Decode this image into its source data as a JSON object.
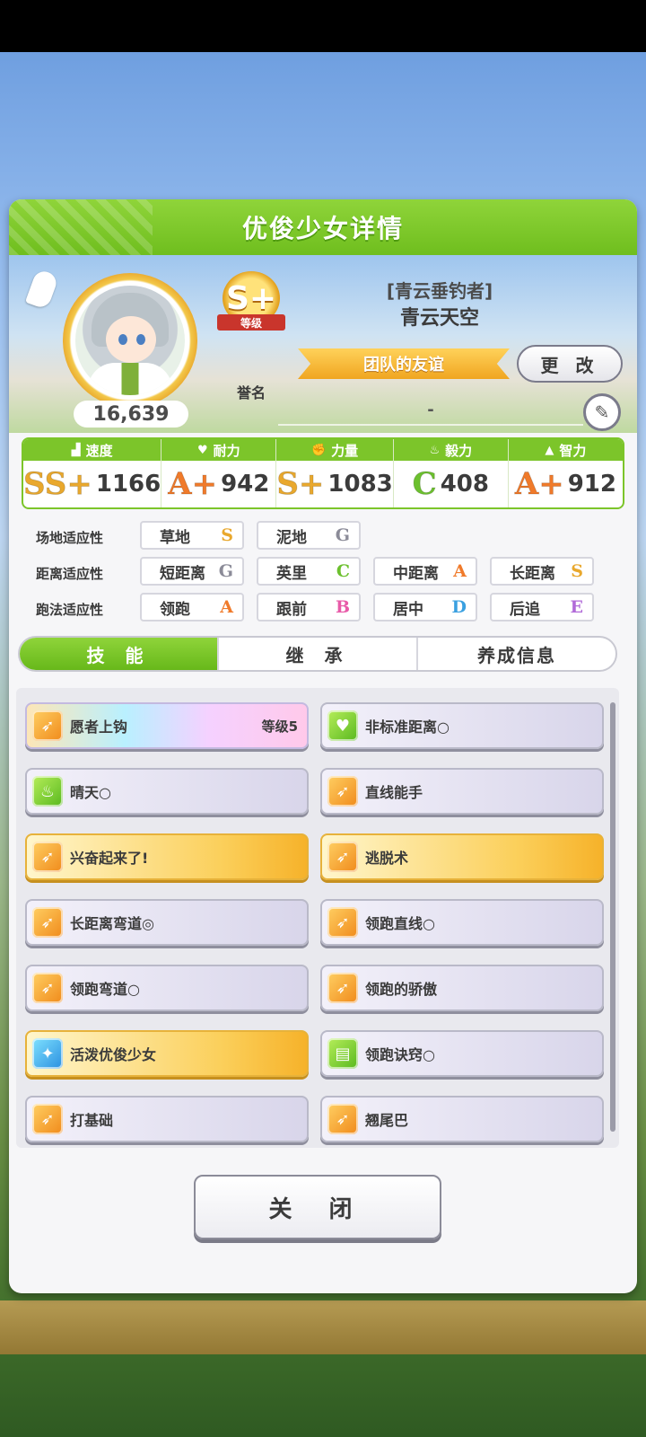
{
  "header": {
    "title": "优俊少女详情"
  },
  "profile": {
    "fans": "16,639",
    "rank": {
      "grade": "S+",
      "ribbon": "等级",
      "label": "誉名"
    },
    "epithet": "[青云垂钓者]",
    "name": "青云天空",
    "title_ribbon": "团队的友谊",
    "change_label": "更 改",
    "placeholder": "-"
  },
  "stats": [
    {
      "label": "速度",
      "icon": "shoe-icon",
      "grade": "SS+",
      "value": "1166",
      "color": "#e9a82d"
    },
    {
      "label": "耐力",
      "icon": "heart-icon",
      "grade": "A+",
      "value": "942",
      "color": "#f07a2a"
    },
    {
      "label": "力量",
      "icon": "arm-icon",
      "grade": "S+",
      "value": "1083",
      "color": "#e9a82d"
    },
    {
      "label": "毅力",
      "icon": "fire-icon",
      "grade": "C",
      "value": "408",
      "color": "#6cc02e"
    },
    {
      "label": "智力",
      "icon": "cap-icon",
      "grade": "A+",
      "value": "912",
      "color": "#f07a2a"
    }
  ],
  "aptitudes": [
    {
      "label": "场地适应性",
      "items": [
        {
          "name": "草地",
          "grade": "S",
          "color": "#e9a82d"
        },
        {
          "name": "泥地",
          "grade": "G",
          "color": "#8b8b98"
        }
      ]
    },
    {
      "label": "距离适应性",
      "items": [
        {
          "name": "短距离",
          "grade": "G",
          "color": "#8b8b98"
        },
        {
          "name": "英里",
          "grade": "C",
          "color": "#6cc02e"
        },
        {
          "name": "中距离",
          "grade": "A",
          "color": "#f07a2a"
        },
        {
          "name": "长距离",
          "grade": "S",
          "color": "#e9a82d"
        }
      ]
    },
    {
      "label": "跑法适应性",
      "items": [
        {
          "name": "领跑",
          "grade": "A",
          "color": "#f07a2a"
        },
        {
          "name": "跟前",
          "grade": "B",
          "color": "#e85aa8"
        },
        {
          "name": "居中",
          "grade": "D",
          "color": "#3aa0e0"
        },
        {
          "name": "后追",
          "grade": "E",
          "color": "#b16ad8"
        }
      ]
    }
  ],
  "tabs": [
    "技 能",
    "继 承",
    "养成信息"
  ],
  "skills": [
    {
      "name": "愿者上钩",
      "level": "等级5",
      "style": "rainbow",
      "icon": "orange"
    },
    {
      "name": "非标准距离○",
      "level": "",
      "style": "",
      "icon": "green"
    },
    {
      "name": "晴天○",
      "level": "",
      "style": "",
      "icon": "green"
    },
    {
      "name": "直线能手",
      "level": "",
      "style": "",
      "icon": "orange"
    },
    {
      "name": "兴奋起来了!",
      "level": "",
      "style": "gold",
      "icon": "orange"
    },
    {
      "name": "逃脱术",
      "level": "",
      "style": "gold",
      "icon": "orange"
    },
    {
      "name": "长距离弯道◎",
      "level": "",
      "style": "",
      "icon": "orange"
    },
    {
      "name": "领跑直线○",
      "level": "",
      "style": "",
      "icon": "orange"
    },
    {
      "name": "领跑弯道○",
      "level": "",
      "style": "",
      "icon": "orange"
    },
    {
      "name": "领跑的骄傲",
      "level": "",
      "style": "",
      "icon": "orange"
    },
    {
      "name": "活泼优俊少女",
      "level": "",
      "style": "gold",
      "icon": "blue"
    },
    {
      "name": "领跑诀窍○",
      "level": "",
      "style": "",
      "icon": "green"
    },
    {
      "name": "打基础",
      "level": "",
      "style": "",
      "icon": "orange"
    },
    {
      "name": "翘尾巴",
      "level": "",
      "style": "",
      "icon": "orange"
    }
  ],
  "close_label": "关 闭"
}
